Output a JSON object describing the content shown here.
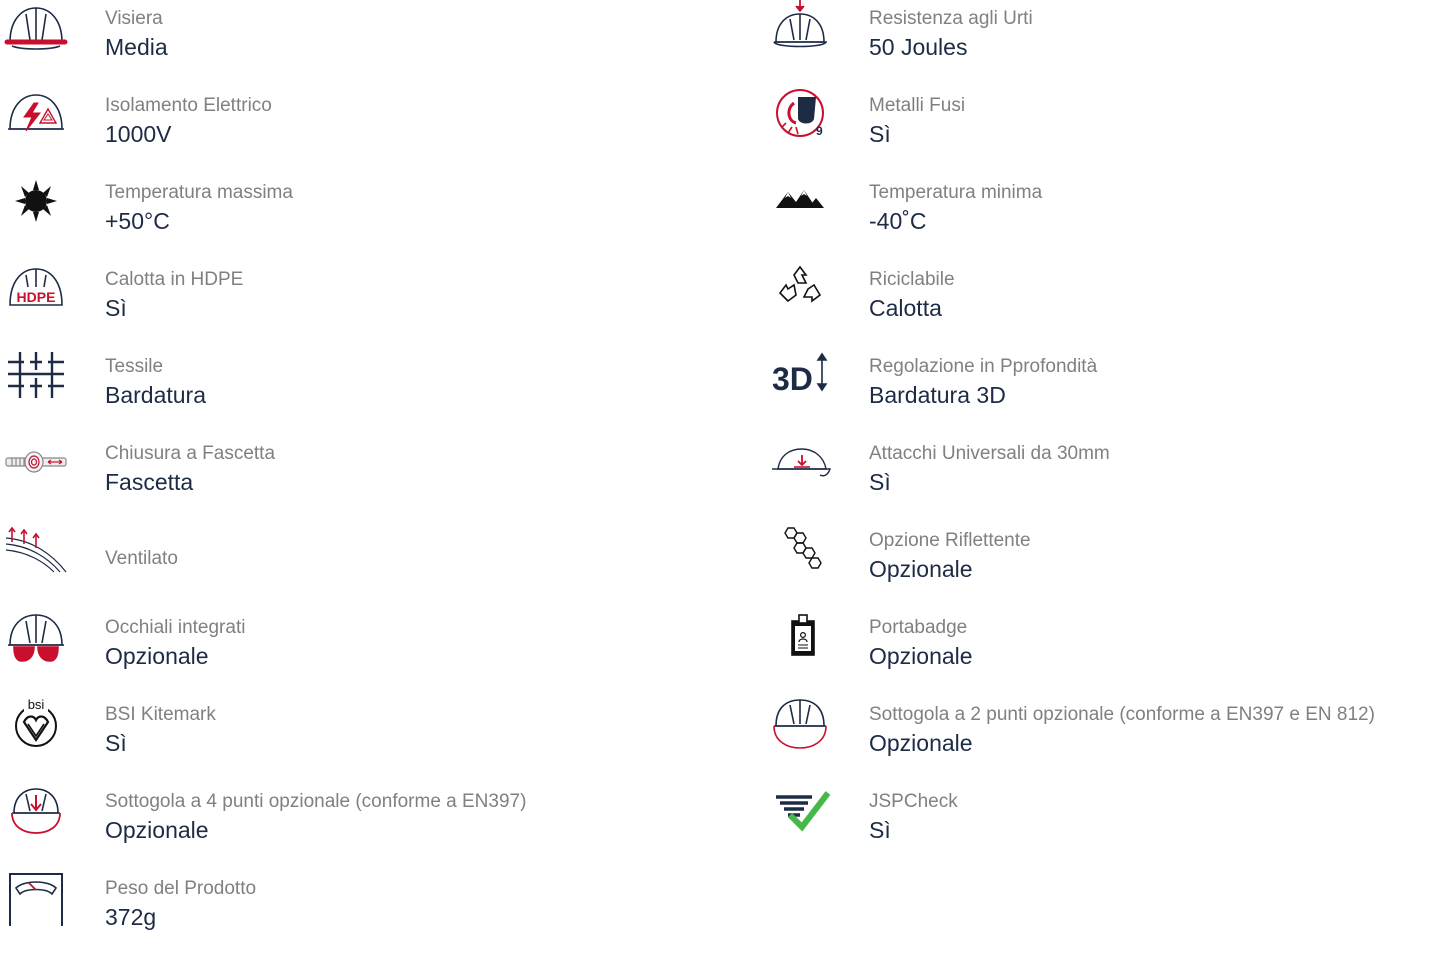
{
  "colors": {
    "accent": "#c8102e",
    "navy": "#1d2b45",
    "label": "#808080",
    "check": "#46b848"
  },
  "left_features": [
    {
      "icon": "visor-helmet-icon",
      "label": "Visiera",
      "value": "Media"
    },
    {
      "icon": "electrical-insulation-icon",
      "label": "Isolamento Elettrico",
      "value": "1000V"
    },
    {
      "icon": "sun-icon",
      "label": "Temperatura massima",
      "value": "+50°C"
    },
    {
      "icon": "hdpe-helmet-icon",
      "label": "Calotta in HDPE",
      "value": "Sì"
    },
    {
      "icon": "textile-icon",
      "label": "Tessile",
      "value": "Bardatura"
    },
    {
      "icon": "ratchet-fastening-icon",
      "label": "Chiusura a Fascetta",
      "value": "Fascetta"
    },
    {
      "icon": "ventilation-icon",
      "label": "Ventilato"
    },
    {
      "icon": "integrated-glasses-icon",
      "label": "Occhiali integrati",
      "value": "Opzionale"
    },
    {
      "icon": "bsi-kitemark-icon",
      "label": "BSI Kitemark",
      "value": "Sì"
    },
    {
      "icon": "chinstrap-4-point-icon",
      "label": "Sottogola a 4 punti opzionale (conforme a EN397)",
      "value": "Opzionale"
    },
    {
      "icon": "scale-weight-icon",
      "label": "Peso del Prodotto",
      "value": "372g"
    }
  ],
  "right_features": [
    {
      "icon": "impact-resistance-icon",
      "label": "Resistenza agli Urti",
      "value": "50 Joules"
    },
    {
      "icon": "molten-metal-icon",
      "label": "Metalli Fusi",
      "value": "Sì"
    },
    {
      "icon": "mountains-icon",
      "label": "Temperatura minima",
      "value": "-40˚C"
    },
    {
      "icon": "recycle-icon",
      "label": "Riciclabile",
      "value": "Calotta"
    },
    {
      "icon": "3d-depth-adjustment-icon",
      "label": "Regolazione in Pprofondità",
      "value": "Bardatura 3D"
    },
    {
      "icon": "universal-slots-icon",
      "label": "Attacchi Universali da 30mm",
      "value": "Sì"
    },
    {
      "icon": "reflective-hexagon-icon",
      "label": "Opzione Riflettente",
      "value": "Opzionale"
    },
    {
      "icon": "badge-holder-icon",
      "label": "Portabadge",
      "value": "Opzionale"
    },
    {
      "icon": "chinstrap-2-point-icon",
      "label": "Sottogola a 2 punti opzionale (conforme a EN397 e EN 812)",
      "value": "Opzionale"
    },
    {
      "icon": "jspcheck-icon",
      "label": "JSPCheck",
      "value": "Sì"
    }
  ]
}
